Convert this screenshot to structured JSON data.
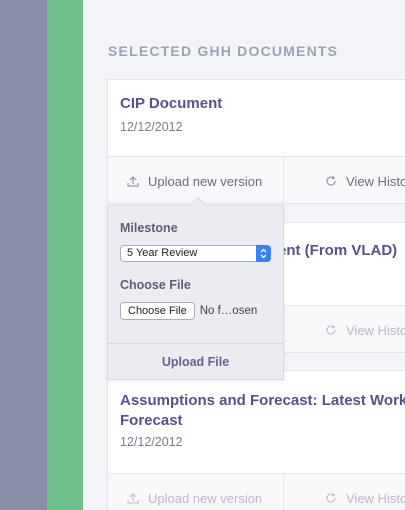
{
  "section_heading": "SELECTED GHH DOCUMENTS",
  "documents": [
    {
      "title": "CIP Document",
      "date": "12/12/2012",
      "upload_label": "Upload new version",
      "history_label": "View Histo"
    },
    {
      "title_visible_fragment": "ent (From VLAD)",
      "upload_label": "",
      "history_label": "View Histo"
    },
    {
      "title_line_1": "Assumptions and Forecast: Latest Workin",
      "title_line_2": "Forecast",
      "date": "12/12/2012",
      "upload_label": "Upload new version",
      "history_label": "View Histo"
    }
  ],
  "upload_popover": {
    "milestone_label": "Milestone",
    "milestone_value": "5 Year Review",
    "choose_file_label": "Choose File",
    "choose_file_button": "Choose File",
    "file_status": "No f…osen",
    "submit_label": "Upload File"
  },
  "colors": {
    "left_rail": "#8a8ea6",
    "green_rail": "#6fc08a",
    "title": "#5d4f8a",
    "select_arrow": "#3b82f0"
  }
}
